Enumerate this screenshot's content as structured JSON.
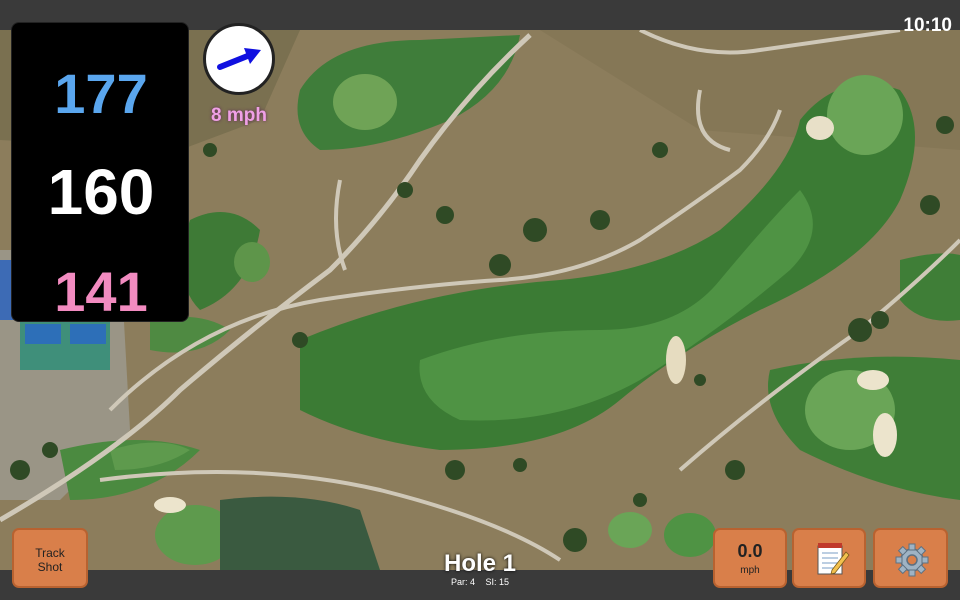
{
  "status_bar": {
    "time": "10:10"
  },
  "distances": {
    "back": "177",
    "middle": "160",
    "front": "141"
  },
  "wind": {
    "speed": "8 mph",
    "direction_icon": "arrow-icon",
    "arrow_color": "#1010e0"
  },
  "buttons": {
    "track_shot_line1": "Track",
    "track_shot_line2": "Shot",
    "speed_value": "0.0",
    "speed_unit": "mph",
    "notes_icon": "notepad-icon",
    "settings_icon": "gear-icon"
  },
  "hole": {
    "title": "Hole 1",
    "par": "Par: 4",
    "si": "SI: 15"
  },
  "colors": {
    "back_distance": "#5aa6ee",
    "middle_distance": "#ffffff",
    "front_distance": "#f28bc0",
    "button": "#d97f4a",
    "wind_text": "#f0a0e6"
  }
}
